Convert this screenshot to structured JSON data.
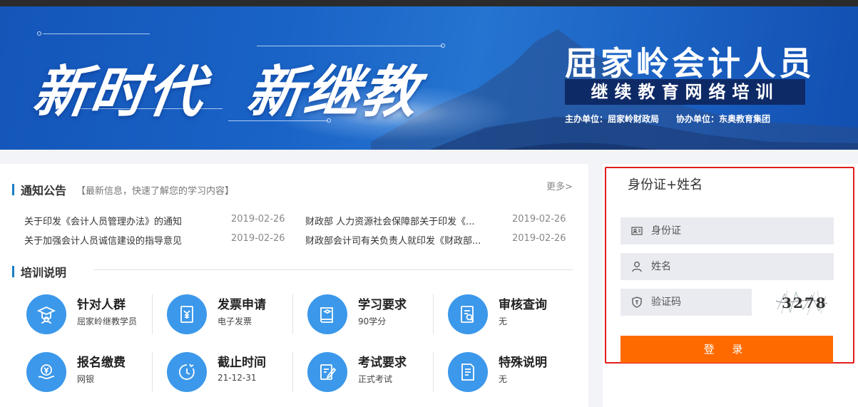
{
  "banner": {
    "slogan_left": "新时代",
    "slogan_right": "新继教",
    "title": "屈家岭会计人员",
    "subtitle": "继续教育网络培训",
    "host": "主办单位：屈家岭财政局",
    "co_host": "协办单位：东奥教育集团"
  },
  "notices": {
    "title": "通知公告",
    "hint": "【最新信息，快速了解您的学习内容】",
    "more": "更多>",
    "items": [
      {
        "text": "关于印发《会计人员管理办法》的通知",
        "date": "2019-02-26"
      },
      {
        "text": "财政部 人力资源社会保障部关于印发《...",
        "date": "2019-02-26"
      },
      {
        "text": "关于加强会计人员诚信建设的指导意见",
        "date": "2019-02-26"
      },
      {
        "text": "财政部会计司有关负责人就印发《财政部...",
        "date": "2019-02-26"
      }
    ]
  },
  "training": {
    "title": "培训说明",
    "cards": [
      {
        "title": "针对人群",
        "sub": "屈家岭继教学员",
        "icon": "graduate-icon"
      },
      {
        "title": "发票申请",
        "sub": "电子发票",
        "icon": "invoice-icon"
      },
      {
        "title": "学习要求",
        "sub": "90学分",
        "icon": "book-icon"
      },
      {
        "title": "审核查询",
        "sub": "无",
        "icon": "audit-search-icon"
      },
      {
        "title": "报名缴费",
        "sub": "网银",
        "icon": "payment-icon"
      },
      {
        "title": "截止时间",
        "sub": "21-12-31",
        "icon": "clock-icon"
      },
      {
        "title": "考试要求",
        "sub": "正式考试",
        "icon": "exam-edit-icon"
      },
      {
        "title": "特殊说明",
        "sub": "无",
        "icon": "document-icon"
      }
    ]
  },
  "login": {
    "title": "身份证+姓名",
    "id_placeholder": "身份证",
    "name_placeholder": "姓名",
    "captcha_placeholder": "验证码",
    "captcha_text": "3278",
    "submit": "登 录"
  },
  "colors": {
    "accent_blue": "#3c98ea",
    "login_orange": "#ff6a00",
    "frame_red": "#e21d1d"
  }
}
